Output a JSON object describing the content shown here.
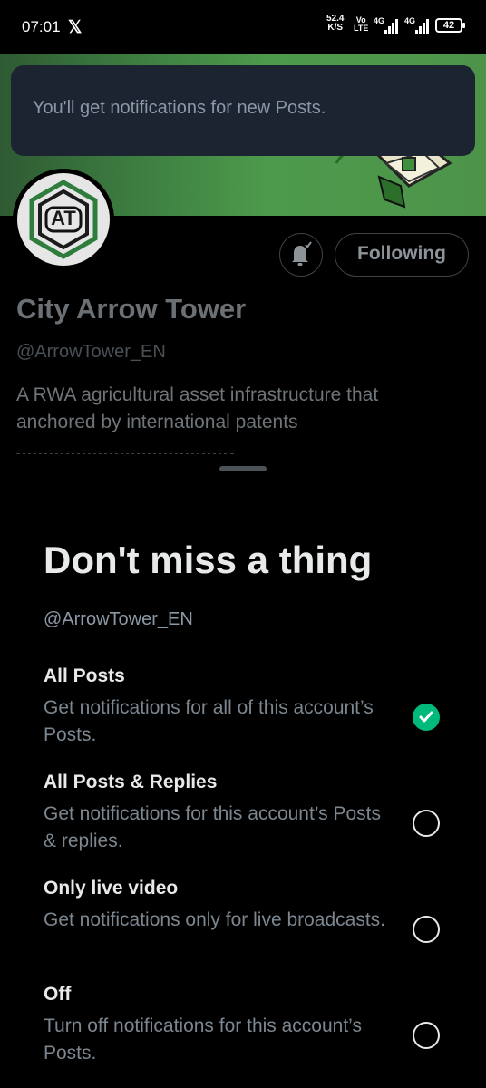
{
  "status_bar": {
    "time": "07:01",
    "speed_value": "52.4",
    "speed_unit": "K/S",
    "volte_top": "Vo",
    "volte_bottom": "LTE",
    "network_1": "4G",
    "network_2": "4G",
    "battery": "42"
  },
  "toast": {
    "message": "You'll get notifications for new Posts."
  },
  "profile": {
    "avatar_text": "AT",
    "display_name": "City Arrow Tower",
    "handle": "@ArrowTower_EN",
    "bio": "A RWA agricultural asset infrastructure that anchored by international patents",
    "follow_button_label": "Following"
  },
  "sheet": {
    "title": "Don't miss a thing",
    "subtitle": "@ArrowTower_EN",
    "options": [
      {
        "title": "All Posts",
        "description": "Get notifications for all of this account’s Posts.",
        "selected": true
      },
      {
        "title": "All Posts & Replies",
        "description": "Get notifications for this account’s Posts & replies.",
        "selected": false
      },
      {
        "title": "Only live video",
        "description": "Get notifications only for live broadcasts.",
        "selected": false
      },
      {
        "title": "Off",
        "description": "Turn off notifications for this account’s Posts.",
        "selected": false
      }
    ]
  },
  "colors": {
    "accent_selected": "#00ba7c",
    "toast_bg": "#1b2430",
    "banner_green": "#4d9a4c"
  }
}
